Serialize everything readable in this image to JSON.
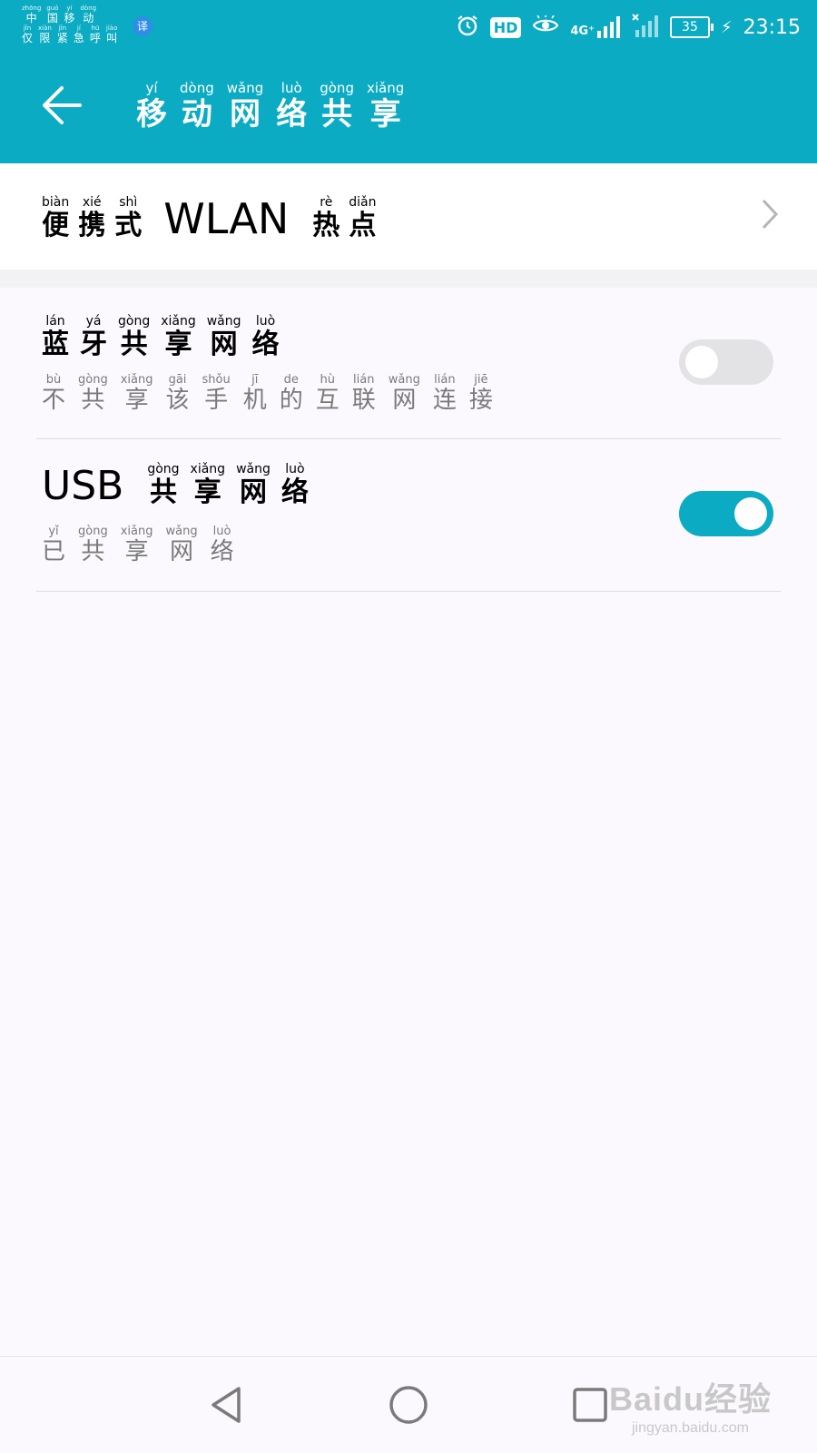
{
  "status_bar": {
    "carrier": {
      "line1": [
        {
          "py": "zhōng",
          "hz": "中"
        },
        {
          "py": "guó",
          "hz": "国"
        },
        {
          "py": "yí",
          "hz": "移"
        },
        {
          "py": "dòng",
          "hz": "动"
        }
      ],
      "line2": [
        {
          "py": "jǐn",
          "hz": "仅"
        },
        {
          "py": "xiàn",
          "hz": "限"
        },
        {
          "py": "jǐn",
          "hz": "紧"
        },
        {
          "py": "jí",
          "hz": "急"
        },
        {
          "py": "hū",
          "hz": "呼"
        },
        {
          "py": "jiào",
          "hz": "叫"
        }
      ]
    },
    "translate_badge": "译",
    "hd": "HD",
    "network": "4G⁺",
    "battery": "35",
    "time": "23:15"
  },
  "app_bar": {
    "title": [
      {
        "py": "yí",
        "hz": "移"
      },
      {
        "py": "dòng",
        "hz": "动"
      },
      {
        "py": "wǎng",
        "hz": "网"
      },
      {
        "py": "luò",
        "hz": "络"
      },
      {
        "py": "gòng",
        "hz": "共"
      },
      {
        "py": "xiǎng",
        "hz": "享"
      }
    ]
  },
  "hotspot": {
    "before": [
      {
        "py": "biàn",
        "hz": "便"
      },
      {
        "py": "xié",
        "hz": "携"
      },
      {
        "py": "shì",
        "hz": "式"
      }
    ],
    "latin": "WLAN",
    "after": [
      {
        "py": "rè",
        "hz": "热"
      },
      {
        "py": "diǎn",
        "hz": "点"
      }
    ]
  },
  "bluetooth": {
    "title": [
      {
        "py": "lán",
        "hz": "蓝"
      },
      {
        "py": "yá",
        "hz": "牙"
      },
      {
        "py": "gòng",
        "hz": "共"
      },
      {
        "py": "xiǎng",
        "hz": "享"
      },
      {
        "py": "wǎng",
        "hz": "网"
      },
      {
        "py": "luò",
        "hz": "络"
      }
    ],
    "subtitle": [
      {
        "py": "bù",
        "hz": "不"
      },
      {
        "py": "gòng",
        "hz": "共"
      },
      {
        "py": "xiǎng",
        "hz": "享"
      },
      {
        "py": "gāi",
        "hz": "该"
      },
      {
        "py": "shǒu",
        "hz": "手"
      },
      {
        "py": "jī",
        "hz": "机"
      },
      {
        "py": "de",
        "hz": "的"
      },
      {
        "py": "hù",
        "hz": "互"
      },
      {
        "py": "lián",
        "hz": "联"
      },
      {
        "py": "wǎng",
        "hz": "网"
      },
      {
        "py": "lián",
        "hz": "连"
      },
      {
        "py": "jiē",
        "hz": "接"
      }
    ],
    "enabled": false
  },
  "usb": {
    "latin": "USB",
    "title": [
      {
        "py": "gòng",
        "hz": "共"
      },
      {
        "py": "xiǎng",
        "hz": "享"
      },
      {
        "py": "wǎng",
        "hz": "网"
      },
      {
        "py": "luò",
        "hz": "络"
      }
    ],
    "subtitle": [
      {
        "py": "yǐ",
        "hz": "已"
      },
      {
        "py": "gòng",
        "hz": "共"
      },
      {
        "py": "xiǎng",
        "hz": "享"
      },
      {
        "py": "wǎng",
        "hz": "网"
      },
      {
        "py": "luò",
        "hz": "络"
      }
    ],
    "enabled": true
  },
  "watermark": {
    "main": "Baidu经验",
    "sub": "jingyan.baidu.com"
  },
  "colors": {
    "accent": "#0aabc3",
    "background": "#fbf9fd"
  }
}
